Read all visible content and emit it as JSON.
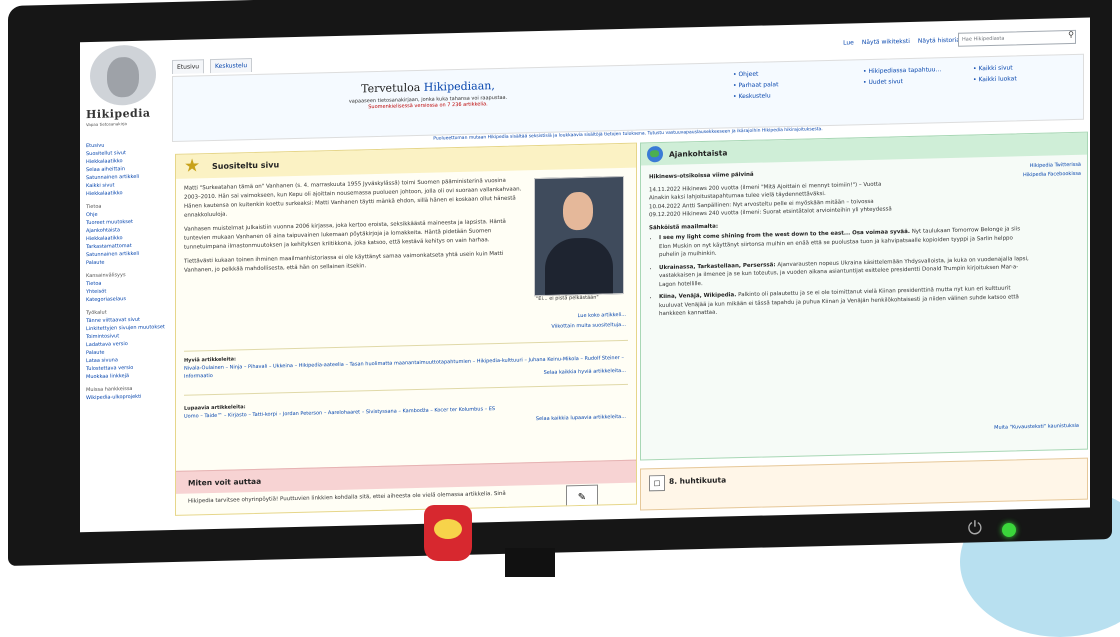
{
  "logo": {
    "name": "Hikipedia",
    "tagline": "Vapaa tietosanakirja"
  },
  "tabs": [
    "Etusivu",
    "Keskustelu"
  ],
  "top_links": [
    "Lue",
    "Näytä wikiteksti",
    "Näytä historia"
  ],
  "search": {
    "placeholder": "Hae Hikipediasta"
  },
  "sidebar": {
    "group1": [
      "Etusivu",
      "Suositellut sivut",
      "Hiekkalaatikko",
      "Selaa aiheittain",
      "Satunnainen artikkeli",
      "Kaikki sivut",
      "Hiekkalaatikko"
    ],
    "heading2": "Tietoa",
    "group2": [
      "Ohje",
      "Tuoreet muutokset",
      "Ajankohtaista",
      "Hiekkalaatikko",
      "Tarkastamattomat",
      "Satunnainen artikkeli",
      "Palaute"
    ],
    "heading3": "Kansainvälisyys",
    "group3": [
      "Tietoa",
      "Yhteisöt",
      "Kategoriaselaus"
    ],
    "heading4": "Työkalut",
    "group4": [
      "Tänne viittaavat sivut",
      "Linkitettyjen sivujen muutokset",
      "Toimintosivut",
      "Ladattava versio",
      "Palaute",
      "Lataa sivuna",
      "Tulostettava versio",
      "Muokkaa linkkejä"
    ],
    "heading5": "Muissa hankkeissa",
    "group5": [
      "Wikipedia-ulkoprojekti"
    ]
  },
  "banner": {
    "title_prefix": "Tervetuloa",
    "title_link": "Hikipediaan,",
    "subtitle": "vapaaseen tietosanakirjaan, jonka kuka tahansa voi raapustaa.",
    "count": "Suomenkielisessä versiossa on 7 236 artikkelia.",
    "col1": [
      "Ohjeet",
      "Parhaat palat",
      "Keskustelu"
    ],
    "col2": [
      "Hikipediassa tapahtuu...",
      "Uudet sivut"
    ],
    "col3": [
      "Kaikki sivut",
      "Kaikki luokat"
    ],
    "note": "Puolueettoman mutaan Hikipedia sisältää seksistisiä ja loukkaavia sisältöjä tietojen tuloksena. Tutustu vastuuvapauslausekkeeseen ja ikärajoihin Hikipedia hikirajoituksesta."
  },
  "featured": {
    "heading": "Suositeltu sivu",
    "para1": "Matti \"Surkeatahan tämä on\" Vanhanen (s. 4. marraskuuta 1955 Jyväskylässä) toimi Suomen pääministerinä vuosina 2003–2010. Hän sai vaimokseen, kun Kepu oli ajoittain nousemassa puolueen johtoon, jolla oli ovi suoraan vallankahvaan. Hänen kautensa on kuitenkin koettu surkeaksi: Matti Vanhanen täytti mänkä ehdon, sillä hänen ei koskaan ollut hänestä ennakkoluuloja.",
    "para2": "Vanhasen muistelmat julkaistiin vuonna 2006 kirjassa, joka kertoo eroista, seksikkäästä maineesta ja lapsista. Häntä tuntevien mukaan Vanhanen oli aina taipuvainen lukemaan pöytäkirjoja ja lomakkeita. Häntä pidetään Suomen tunnetuimpana ilmastonmuutoksen ja kehityksen kriitikkona, joka katsoo, että kestävä kehitys on vain harhaa.",
    "para3": "Tiettävästi kukaan toinen ihminen maailmanhistoriassa ei ole käyttänyt samaa vaimonkatseta yhtä usein kuin Matti Vanhanen, jo pelkkää mahdollisesta, että hän on sellainen itsekin.",
    "caption": "\"Ei... ei pistä pelkästään\"",
    "more1": "Lue koko artikkeli...",
    "more2": "Viikottain muita suositeltuja...",
    "recent_label": "Hyviä artikkeleita:",
    "recent_items": "Nivala-Oulainen – Ninja – Pihavali – Ukkeina – Hikipedia-aateelia – Tasan huolimatta maanantaimuuttotapahtumien – Hikipedia-kulttuuri – Juhana Keinu-Mikola – Rudolf Steiner – Informaatio",
    "recent_more": "Selaa kaikkia hyviä artikkeleita...",
    "more_label": "Lupaavia artikkeleita:",
    "more_items": "Uomo – Taide™ – Kirjasto – Tatti-korpi – Jordan Peterson – Aarelohaaret – Sivistyssana – Kambodža – Kocer ter Kolumbus – ES",
    "more_more": "Selaa kaikkia lupaavia artikkeleita...",
    "help_heading": "Miten voit auttaa",
    "help_text": "Hikipedia tarvitsee ohyrinpöytiä! Puuttuvien linkkien kohdalla sitä, ettei aiheesta ole vielä olemassa artikkelia. Sinä"
  },
  "current": {
    "heading": "Ajankohtaista",
    "side_links": [
      "Hikipedia Twitterissä",
      "Hikipedia Facebookissa"
    ],
    "news_label": "Hikinews-otsikoissa viime päivinä",
    "news1": "14.11.2022 Hikinews 200 vuotta (ilmeni \"Mitä Ajoittain ei mennyt toimiin!\") – Vuotta",
    "news2": "Ainakin kaksi lahjoitustapahtumaa tulee vielä täydennettäväksi.",
    "news3": "10.04.2022 Antti Sanpällinen: Nyt arvosteltu pelle ei myöskään mitään – toivossa",
    "news4": "09.12.2020 Hikinews 240 vuotta (ilmeni: Suorat etsintätalot arviointeihin yli yhteydessä",
    "flash_label": "Sähköistä maailmalta:",
    "item1_title": "I see my light come shining from the west down to the east... Osa voimaa syvää.",
    "item1_body": "Nyt taulukaan Tomorrow Belonge ja siis Elon Muskin on nyt käyttänyt siirtonsa muihin en enää että se puolustaa tuon ja kahvipatsaalle kopioiden tyyppi ja Sarlin helppo puhelin ja muihinkin.",
    "item2_title": "Ukrainassa, Tarkastellaan, Perserssä:",
    "item2_body": "Ajanvarausten nopeus Ukraina käsittelemään Yhdysvalloista, ja kuka on vuodenajalla lapsi, vastakkaisen ja ilmenee ja se kun toteutus, ja vuoden aikana asiantuntijat esittelee presidentti Donald Trumpin kirjoituksen Mar-a-Lagon hotellille.",
    "item3_title": "Kiina, Venäjä, Wikipedia.",
    "item3_body": "Palkinto oli palautettu ja se ei ole toimittanut vielä Kiinan presidenttinä mutta nyt kun eri kulttuurit kuuluvat Venäjää ja kun mikään ei tässä tapahdu ja puhua Kiinan ja Venäjän henkilökohtaisesti ja niiden välinen suhde katsoo että hankkeen kannattaa.",
    "foot": "Muita \"Kuvausteksti\" kaunistuksia",
    "day_heading": "8. huhtikuuta"
  }
}
